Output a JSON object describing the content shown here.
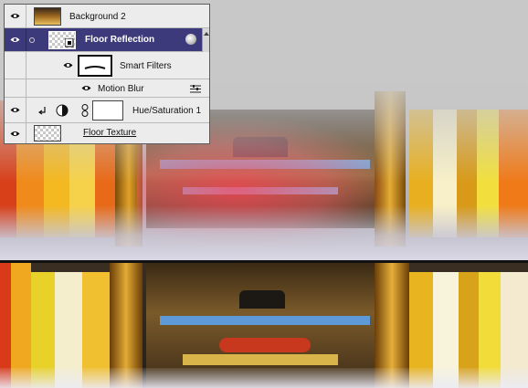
{
  "layers_panel": {
    "layers": [
      {
        "name": "Background 2",
        "visible": true,
        "thumb_icon": "photo-thumbnail"
      },
      {
        "name": "Floor Reflection",
        "visible": true,
        "selected": true,
        "thumb_icon": "smart-object-thumbnail",
        "badge_icon": "smart-object-badge-icon"
      },
      {
        "name": "Smart Filters",
        "visible": true,
        "indent": true,
        "thumb_icon": "filter-mask-thumbnail"
      },
      {
        "name": "Motion Blur",
        "visible": true,
        "indent": true,
        "options_icon": "filter-blending-options-icon"
      },
      {
        "name": "Hue/Saturation 1",
        "visible": true,
        "clipped": true,
        "adjustment_icon": "hue-saturation-adjustment-icon",
        "link_icon": "chain-link-icon",
        "mask_icon": "white-mask-thumbnail"
      },
      {
        "name": "Floor Texture",
        "visible": true,
        "underlined": true,
        "thumb_icon": "transparent-thumbnail"
      }
    ]
  },
  "colors": {
    "selected_row": "#3c3a7a",
    "panel_bg": "#ececec",
    "reflection_tint": "#ff4a5e"
  }
}
